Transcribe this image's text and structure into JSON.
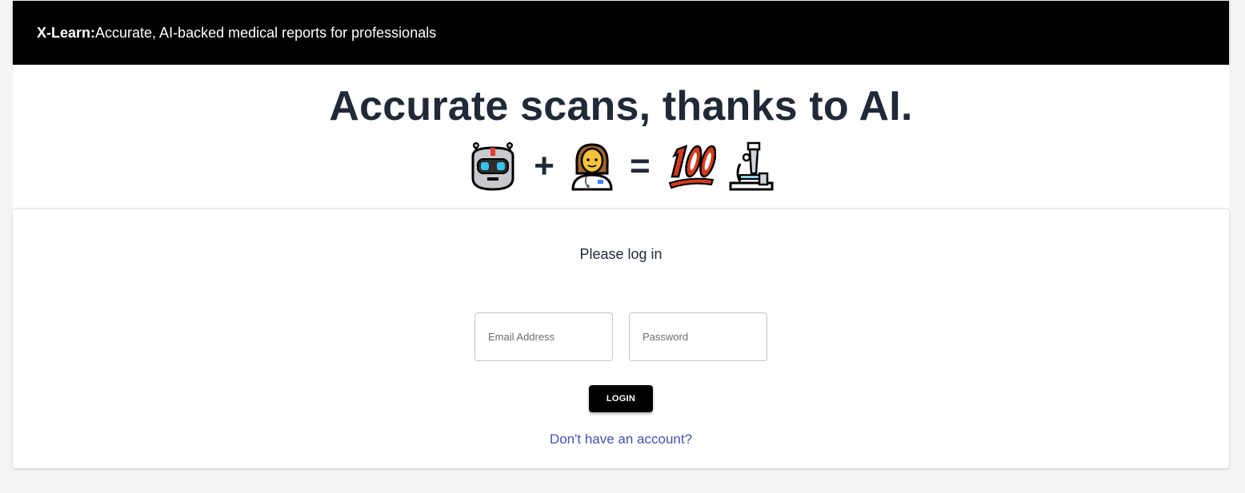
{
  "appbar": {
    "brand": "X-Learn:",
    "tagline": "Accurate, AI-backed medical reports for professionals"
  },
  "hero": {
    "title": "Accurate scans, thanks to AI.",
    "equation": {
      "icons": [
        "robot-icon",
        "woman-health-worker-icon",
        "hundred-points-icon",
        "microscope-icon"
      ],
      "plus": "+",
      "equals": "="
    }
  },
  "login": {
    "prompt": "Please log in",
    "email": {
      "placeholder": "Email Address",
      "value": ""
    },
    "password": {
      "placeholder": "Password",
      "value": ""
    },
    "button_label": "LOGIN",
    "signup_link": "Don't have an account?"
  },
  "colors": {
    "appbar_bg": "#000000",
    "page_bg": "#f3f4f6",
    "title_text": "#1f2937",
    "link": "#3f51b5"
  }
}
